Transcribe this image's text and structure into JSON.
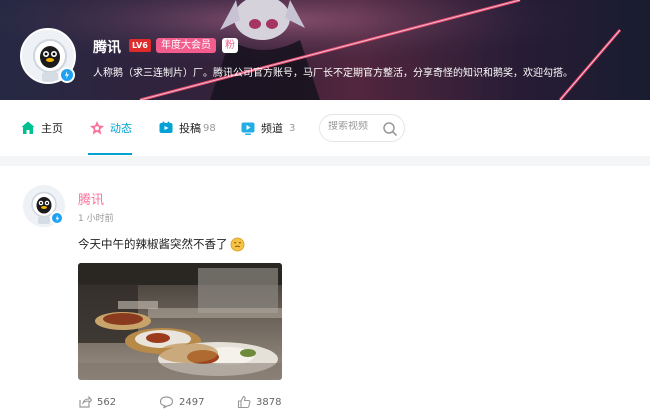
{
  "profile": {
    "name": "腾讯",
    "level_badge": "LV6",
    "vip_badge": "年度大会员",
    "fan_badge": "粉",
    "bio": "人称鹅（求三连制片）厂。腾讯公司官方账号，马厂长不定期官方整活，分享奇怪的知识和鹅奖，欢迎勾搭。"
  },
  "nav": {
    "items": [
      {
        "label": "主页",
        "count": null,
        "icon": "home-icon"
      },
      {
        "label": "动态",
        "count": null,
        "icon": "dynamic-icon"
      },
      {
        "label": "投稿",
        "count": "98",
        "icon": "upload-icon"
      },
      {
        "label": "频道",
        "count": "3",
        "icon": "channel-icon"
      }
    ],
    "active_index": 1,
    "search_placeholder": "搜索视频"
  },
  "post": {
    "author": "腾讯",
    "time": "1 小时前",
    "text": "今天中午的辣椒酱突然不香了",
    "emoji": "face-emoji",
    "shares": "562",
    "comments": "2497",
    "likes": "3878"
  },
  "colors": {
    "accent": "#00a1d6",
    "pink": "#fb7299",
    "vip": "#f25d8e",
    "level": "#e02b2b",
    "verify": "#1da1f2"
  }
}
